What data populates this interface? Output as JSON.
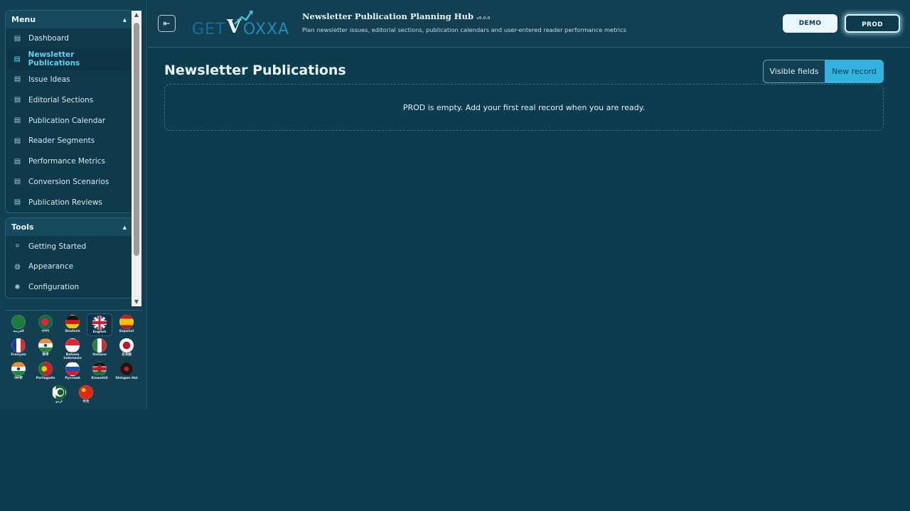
{
  "sidebar": {
    "menu": {
      "title": "Menu",
      "items": [
        {
          "label": "Dashboard"
        },
        {
          "label": "Newsletter Publications",
          "active": true
        },
        {
          "label": "Issue Ideas"
        },
        {
          "label": "Editorial Sections"
        },
        {
          "label": "Publication Calendar"
        },
        {
          "label": "Reader Segments"
        },
        {
          "label": "Performance Metrics"
        },
        {
          "label": "Conversion Scenarios"
        },
        {
          "label": "Publication Reviews"
        }
      ]
    },
    "tools": {
      "title": "Tools",
      "items": [
        {
          "label": "Getting Started",
          "icon": "crop-icon"
        },
        {
          "label": "Appearance",
          "icon": "palette-icon"
        },
        {
          "label": "Configuration",
          "icon": "gear-icon"
        }
      ]
    },
    "languages": [
      {
        "label": "العربية",
        "flag": "saudi-arabia"
      },
      {
        "label": "বাংলা",
        "flag": "bangladesh"
      },
      {
        "label": "Deutsch",
        "flag": "germany"
      },
      {
        "label": "English",
        "flag": "united-kingdom",
        "selected": true
      },
      {
        "label": "Español",
        "flag": "spain"
      },
      {
        "label": "Français",
        "flag": "france"
      },
      {
        "label": "हिन्दी",
        "flag": "india"
      },
      {
        "label": "Bahasa Indonesia",
        "flag": "indonesia"
      },
      {
        "label": "Italiano",
        "flag": "italy"
      },
      {
        "label": "日本語",
        "flag": "japan"
      },
      {
        "label": "ਪੰਜਾਬੀ",
        "flag": "india"
      },
      {
        "label": "Português",
        "flag": "portugal"
      },
      {
        "label": "Русский",
        "flag": "russia"
      },
      {
        "label": "Kiswahili",
        "flag": "kenya"
      },
      {
        "label": "Shingon Hai",
        "flag": "shingon"
      },
      {
        "label": "اردو",
        "flag": "pakistan"
      },
      {
        "label": "中文",
        "flag": "china"
      }
    ]
  },
  "header": {
    "logo_text_left": "GET",
    "logo_text_right": "OXXA",
    "logo_mark": "V",
    "title": "Newsletter Publication Planning Hub",
    "version": "v9.0.0",
    "subtitle": "Plan newsletter issues, editorial sections, publication calendars and user-entered reader performance metrics",
    "env_demo": "DEMO",
    "env_prod": "PROD",
    "collapse_icon": "sidebar-collapse-icon"
  },
  "main": {
    "title": "Newsletter Publications",
    "visible_fields_label": "Visible fields",
    "new_record_label": "New record",
    "empty_message": "PROD is empty. Add your first real record when you are ready."
  },
  "colors": {
    "background": "#0d3c4f",
    "accent": "#34b3e0",
    "active_nav": "#5fd2f0"
  }
}
